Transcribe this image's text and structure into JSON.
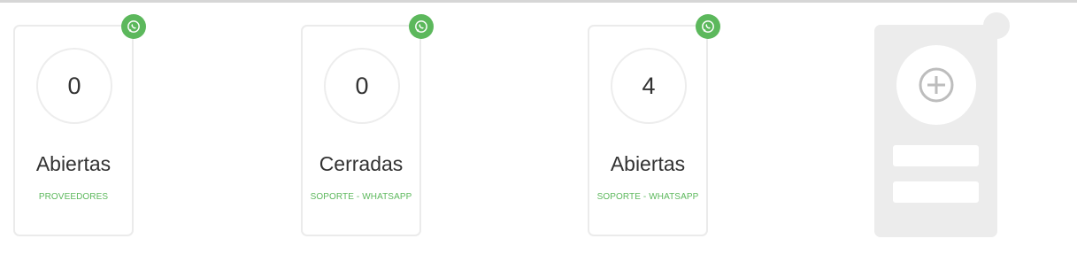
{
  "cards": [
    {
      "count": "0",
      "status": "Abiertas",
      "category": "PROVEEDORES",
      "badge_icon": "whatsapp-icon"
    },
    {
      "count": "0",
      "status": "Cerradas",
      "category": "SOPORTE - WHATSAPP",
      "badge_icon": "whatsapp-icon"
    },
    {
      "count": "4",
      "status": "Abiertas",
      "category": "SOPORTE - WHATSAPP",
      "badge_icon": "whatsapp-icon"
    }
  ],
  "add_card": {
    "icon": "plus-circle-icon"
  },
  "colors": {
    "accent_green": "#5cb85c",
    "border": "#ebebeb",
    "placeholder": "#ececec",
    "text": "#333333"
  }
}
